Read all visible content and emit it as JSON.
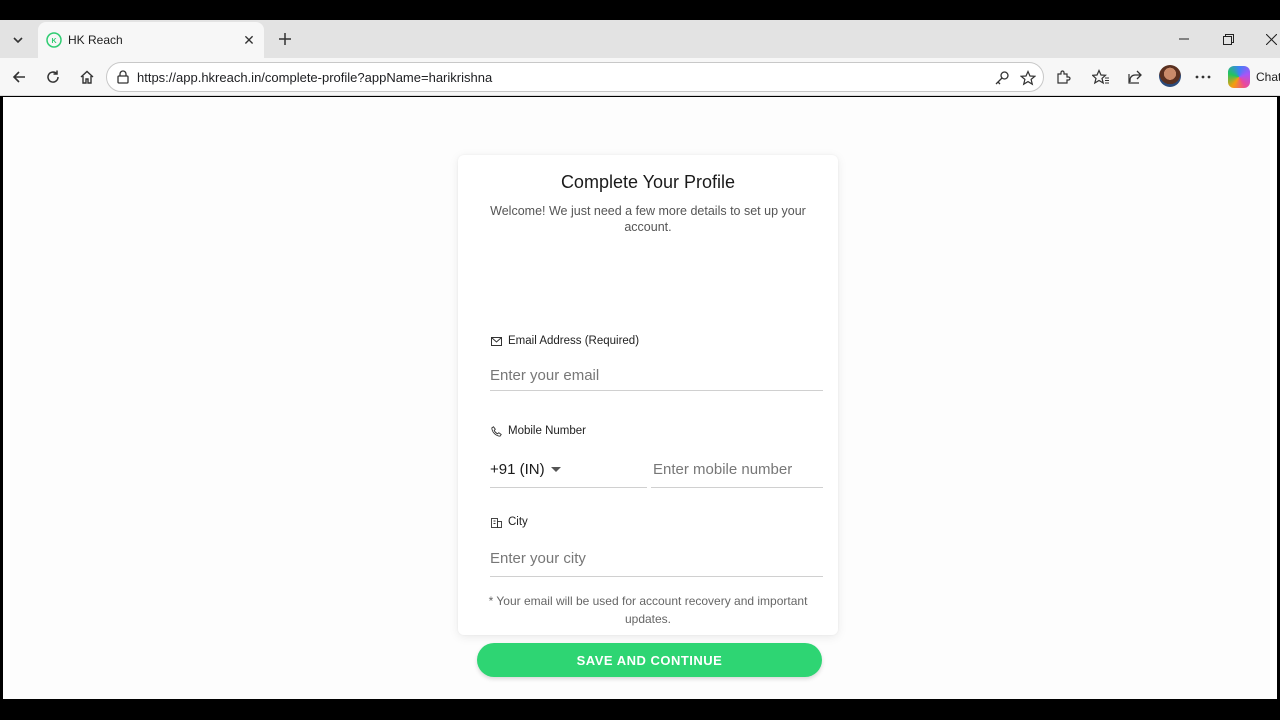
{
  "browser": {
    "tab": {
      "title": "HK Reach",
      "favicon_icon": "hk-reach-logo-icon"
    },
    "url": "https://app.hkreach.in/complete-profile?appName=harikrishna",
    "chat_label": "Chat"
  },
  "colors": {
    "accent": "#2ed573",
    "accent_dark": "#1aa35a"
  },
  "form": {
    "title": "Complete Your Profile",
    "subtitle": "Welcome! We just need a few more details to set up your account.",
    "email": {
      "label": "Email Address (Required)",
      "placeholder": "Enter your email",
      "icon": "mail-icon"
    },
    "mobile": {
      "label": "Mobile Number",
      "country_code": "+91 (IN)",
      "placeholder": "Enter mobile number",
      "icon": "phone-icon"
    },
    "city": {
      "label": "City",
      "placeholder": "Enter your city",
      "icon": "building-icon"
    },
    "note": "* Your email will be used for account recovery and important updates.",
    "submit_label": "SAVE AND CONTINUE"
  }
}
